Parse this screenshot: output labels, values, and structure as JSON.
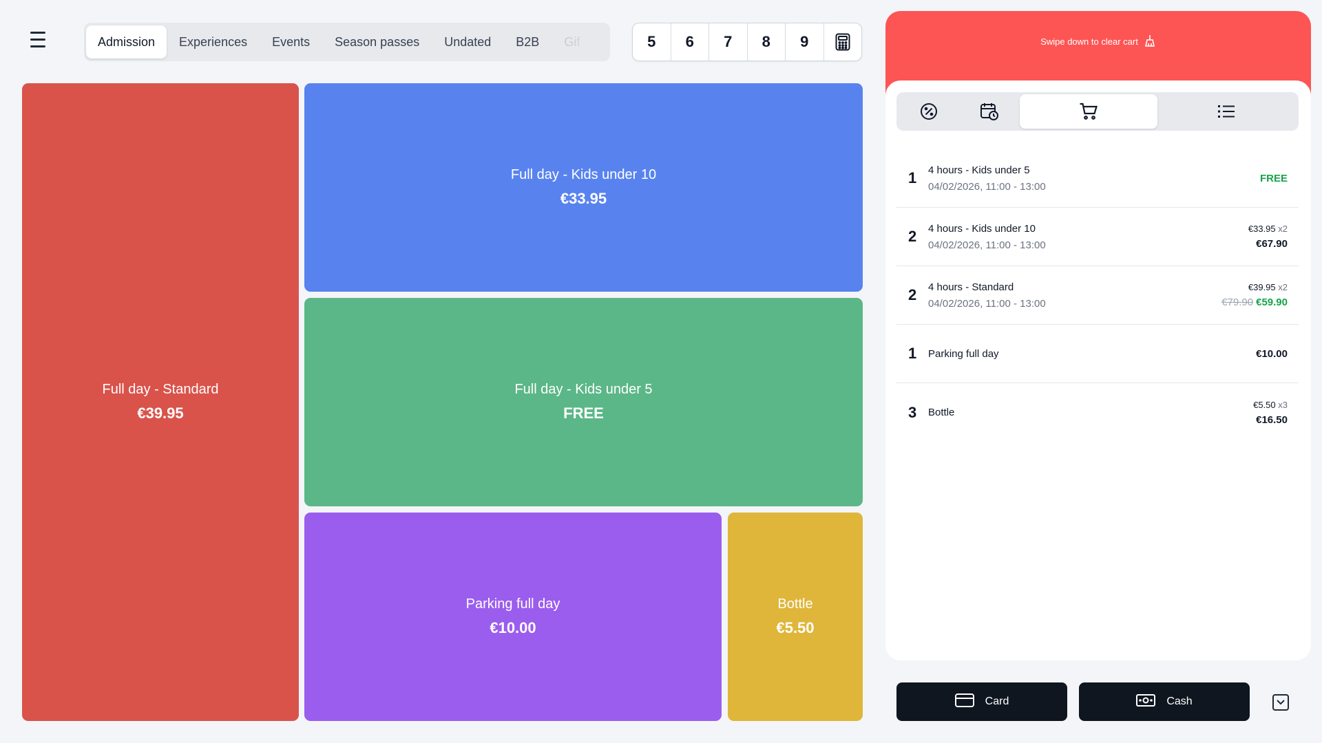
{
  "tabs": [
    "Admission",
    "Experiences",
    "Events",
    "Season passes",
    "Undated",
    "B2B",
    "Gif"
  ],
  "active_tab": "Admission",
  "quick_qty": [
    "5",
    "6",
    "7",
    "8",
    "9"
  ],
  "tiles": [
    {
      "name": "Full day - Standard",
      "price": "€39.95",
      "color": "#d9534b"
    },
    {
      "name": "Full day - Kids under 10",
      "price": "€33.95",
      "color": "#5883ef"
    },
    {
      "name": "Full day - Kids under 5",
      "price": "FREE",
      "color": "#5bb787"
    },
    {
      "name": "Parking full day",
      "price": "€10.00",
      "color": "#9b5ded"
    },
    {
      "name": "Bottle",
      "price": "€5.50",
      "color": "#dfb63a"
    }
  ],
  "cart": {
    "swipe_text": "Swipe down to clear cart",
    "header_color": "#fd5554",
    "items": [
      {
        "qty": "1",
        "name": "4 hours - Kids under 5",
        "date": "04/02/2026, 11:00 - 13:00",
        "free": "FREE"
      },
      {
        "qty": "2",
        "name": "4 hours - Kids under 10",
        "date": "04/02/2026, 11:00 - 13:00",
        "unit": "€33.95",
        "mult": "x2",
        "total": "€67.90"
      },
      {
        "qty": "2",
        "name": "4 hours - Standard",
        "date": "04/02/2026, 11:00 - 13:00",
        "unit": "€39.95",
        "mult": "x2",
        "old_total": "€79.90",
        "total": "€59.90"
      },
      {
        "qty": "1",
        "name": "Parking full day",
        "total": "€10.00"
      },
      {
        "qty": "3",
        "name": "Bottle",
        "unit": "€5.50",
        "mult": "x3",
        "total": "€16.50"
      }
    ]
  },
  "payment": {
    "card": "Card",
    "cash": "Cash"
  }
}
